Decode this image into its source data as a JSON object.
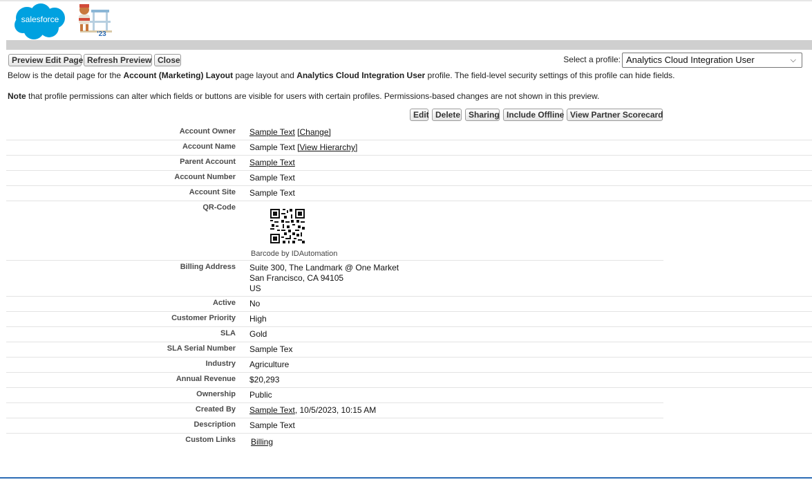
{
  "header": {
    "logo_text": "salesforce",
    "mascot_badge": "'23"
  },
  "toolbar": {
    "preview_edit_page": "Preview Edit Page",
    "refresh_preview": "Refresh Preview",
    "close": "Close",
    "profile_label": "Select a profile:",
    "profile_selected": "Analytics Cloud Integration User"
  },
  "intro": {
    "desc_1": "Below is the detail page for the ",
    "desc_layout": "Account (Marketing) Layout",
    "desc_2": " page layout and ",
    "desc_profile": "Analytics Cloud Integration User",
    "desc_3": " profile. The field-level security settings of this profile can hide fields.",
    "note_bold": "Note",
    "note_rest": " that profile permissions can alter which fields or buttons are visible for users with certain profiles. Permissions-based changes are not shown in this preview."
  },
  "detail_buttons": {
    "edit": "Edit",
    "delete": "Delete",
    "sharing": "Sharing",
    "include_offline": "Include Offline",
    "view_partner_scorecard": "View Partner Scorecard"
  },
  "fields": {
    "account_owner": {
      "label": "Account Owner",
      "value": "Sample Text",
      "link": "[Change]"
    },
    "account_name": {
      "label": "Account Name",
      "value": "Sample Text",
      "link": "[View Hierarchy]"
    },
    "parent_account": {
      "label": "Parent Account",
      "value": "Sample Text"
    },
    "account_number": {
      "label": "Account Number",
      "value": "Sample Text"
    },
    "account_site": {
      "label": "Account Site",
      "value": "Sample Text"
    },
    "qr_code": {
      "label": "QR-Code",
      "caption": "Barcode by IDAutomation"
    },
    "billing_address": {
      "label": "Billing Address",
      "line1": "Suite 300, The Landmark @ One Market",
      "line2": "San Francisco, CA 94105",
      "line3": "US"
    },
    "active": {
      "label": "Active",
      "value": "No"
    },
    "customer_priority": {
      "label": "Customer Priority",
      "value": "High"
    },
    "sla": {
      "label": "SLA",
      "value": "Gold"
    },
    "sla_serial_number": {
      "label": "SLA Serial Number",
      "value": "Sample Tex"
    },
    "industry": {
      "label": "Industry",
      "value": "Agriculture"
    },
    "annual_revenue": {
      "label": "Annual Revenue",
      "value": "$20,293"
    },
    "ownership": {
      "label": "Ownership",
      "value": "Public"
    },
    "created_by": {
      "label": "Created By",
      "value": "Sample Text",
      "rest": ", 10/5/2023, 10:15 AM"
    },
    "description": {
      "label": "Description",
      "value": "Sample Text"
    },
    "custom_links": {
      "label": "Custom Links",
      "value": "Billing"
    }
  },
  "colors": {
    "salesforce_blue": "#00a1e0",
    "gray_bar": "#cfcfcf",
    "bottom_rule": "#2b6cb5"
  }
}
